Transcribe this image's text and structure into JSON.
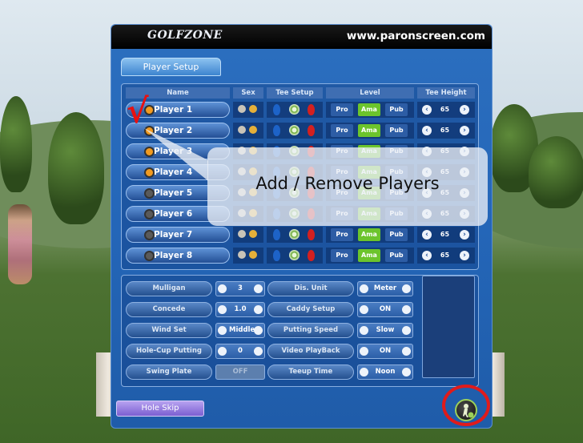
{
  "header": {
    "logo": "GOLFZONE",
    "url": "www.paronscreen.com"
  },
  "tab": {
    "label": "Player Setup"
  },
  "columns": [
    "Name",
    "Sex",
    "Tee Setup",
    "Level",
    "Tee Height"
  ],
  "players": [
    {
      "name": "Player 1",
      "ball": "#f29a1f",
      "level": {
        "pro": "Pro",
        "ama": "Ama",
        "pub": "Pub"
      },
      "tee_height": "65"
    },
    {
      "name": "Player 2",
      "ball": "#f29a1f",
      "level": {
        "pro": "Pro",
        "ama": "Ama",
        "pub": "Pub"
      },
      "tee_height": "65"
    },
    {
      "name": "Player 3",
      "ball": "#f29a1f",
      "level": {
        "pro": "Pro",
        "ama": "Ama",
        "pub": "Pub"
      },
      "tee_height": "65"
    },
    {
      "name": "Player 4",
      "ball": "#f29a1f",
      "level": {
        "pro": "Pro",
        "ama": "Ama",
        "pub": "Pub"
      },
      "tee_height": "65"
    },
    {
      "name": "Player 5",
      "ball": "#5a5a5a",
      "level": {
        "pro": "Pro",
        "ama": "Ama",
        "pub": "Pub"
      },
      "tee_height": "65"
    },
    {
      "name": "Player 6",
      "ball": "#5a5a5a",
      "level": {
        "pro": "Pro",
        "ama": "Ama",
        "pub": "Pub"
      },
      "tee_height": "65"
    },
    {
      "name": "Player 7",
      "ball": "#5a5a5a",
      "level": {
        "pro": "Pro",
        "ama": "Ama",
        "pub": "Pub"
      },
      "tee_height": "65"
    },
    {
      "name": "Player 8",
      "ball": "#5a5a5a",
      "level": {
        "pro": "Pro",
        "ama": "Ama",
        "pub": "Pub"
      },
      "tee_height": "65"
    }
  ],
  "options_left": [
    {
      "label": "Mulligan",
      "value": "3"
    },
    {
      "label": "Concede",
      "value": "1.0"
    },
    {
      "label": "Wind Set",
      "value": "Middle"
    },
    {
      "label": "Hole-Cup Putting",
      "value": "0"
    },
    {
      "label": "Swing Plate",
      "value": "OFF"
    }
  ],
  "options_right": [
    {
      "label": "Dis. Unit",
      "value": "Meter"
    },
    {
      "label": "Caddy Setup",
      "value": "ON"
    },
    {
      "label": "Putting Speed",
      "value": "Slow"
    },
    {
      "label": "Video PlayBack",
      "value": "ON"
    },
    {
      "label": "Teeup Time",
      "value": "Noon"
    }
  ],
  "hole_skip": "Hole Skip",
  "callout": {
    "text": "Add / Remove Players",
    "mark": "√"
  },
  "colors": {
    "accent": "#2466b8",
    "ama": "#6cc42c",
    "annotation": "#e01b1b"
  }
}
